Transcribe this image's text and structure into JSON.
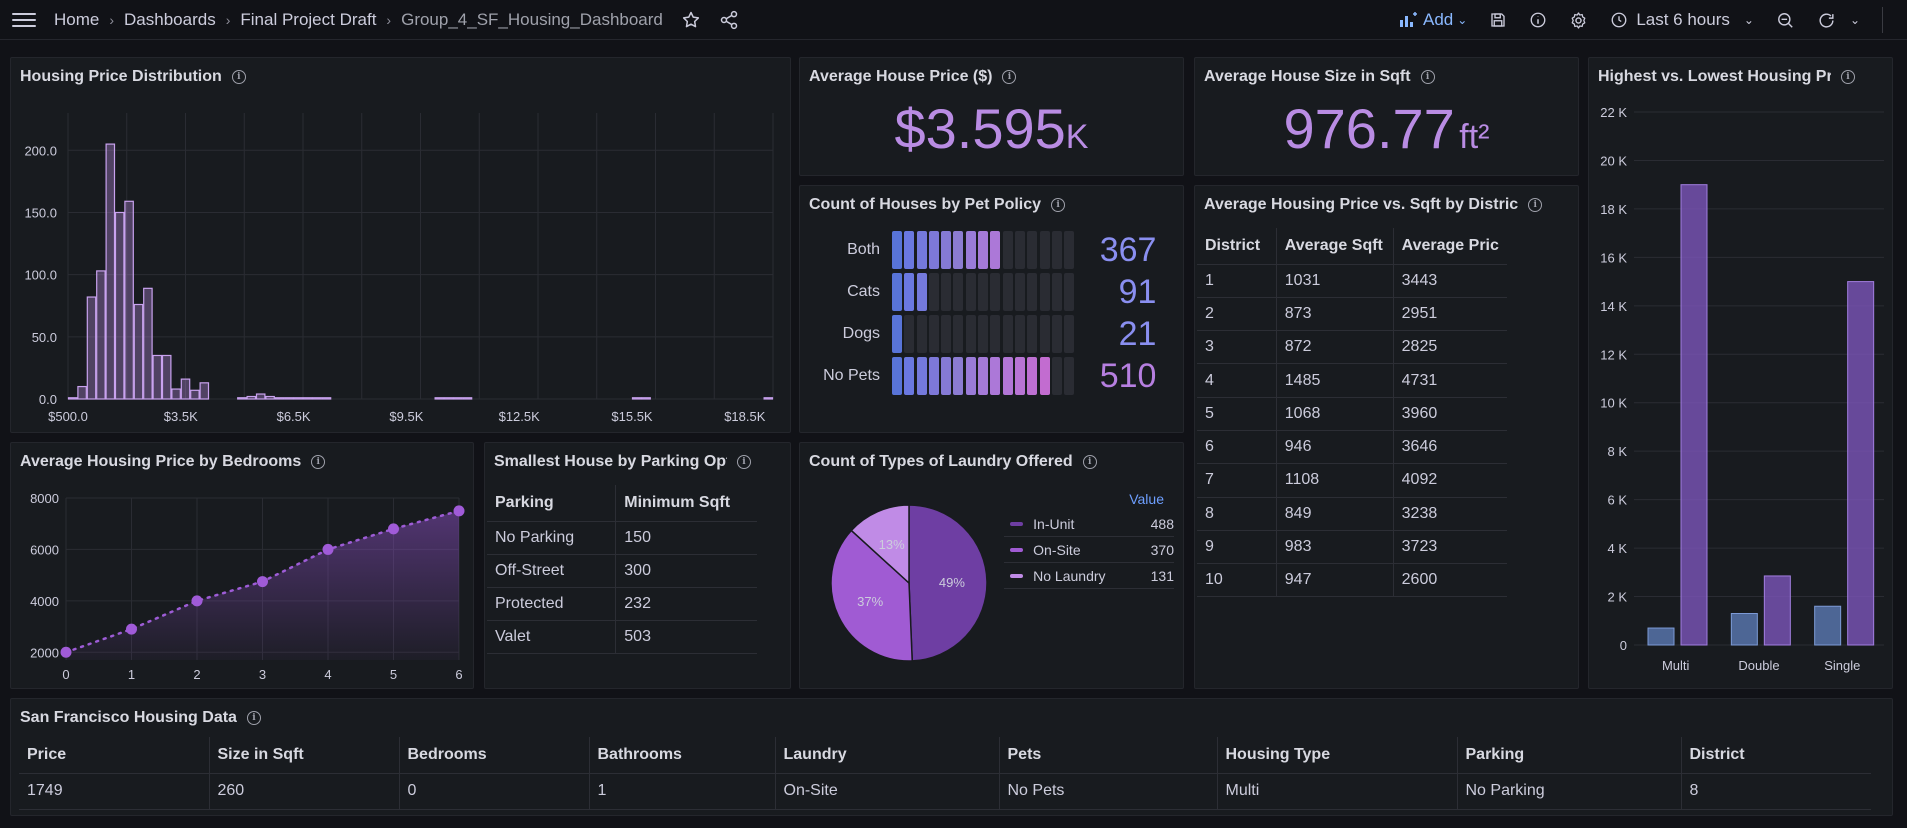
{
  "topbar": {
    "breadcrumbs": [
      "Home",
      "Dashboards",
      "Final Project Draft",
      "Group_4_SF_Housing_Dashboard"
    ],
    "add_label": "Add",
    "time_range": "Last 6 hours"
  },
  "panels": {
    "histogram": {
      "title": "Housing Price Distribution"
    },
    "avg_price": {
      "title": "Average House Price ($)",
      "value": "$3.595",
      "unit": "K"
    },
    "avg_size": {
      "title": "Average House Size in Sqft",
      "value": "976.77",
      "unit": "ft²"
    },
    "high_low": {
      "title": "Highest vs. Lowest Housing Pr"
    },
    "pet_policy": {
      "title": "Count of Houses by Pet Policy",
      "rows": [
        {
          "label": "Both",
          "value": "367",
          "lit": 9
        },
        {
          "label": "Cats",
          "value": "91",
          "lit": 3
        },
        {
          "label": "Dogs",
          "value": "21",
          "lit": 1
        },
        {
          "label": "No Pets",
          "value": "510",
          "lit": 13
        }
      ]
    },
    "district_table": {
      "title": "Average Housing Price vs. Sqft by Distric",
      "headers": [
        "District",
        "Average Sqft",
        "Average Pric"
      ],
      "rows": [
        [
          "1",
          "1031",
          "3443"
        ],
        [
          "2",
          "873",
          "2951"
        ],
        [
          "3",
          "872",
          "2825"
        ],
        [
          "4",
          "1485",
          "4731"
        ],
        [
          "5",
          "1068",
          "3960"
        ],
        [
          "6",
          "946",
          "3646"
        ],
        [
          "7",
          "1108",
          "4092"
        ],
        [
          "8",
          "849",
          "3238"
        ],
        [
          "9",
          "983",
          "3723"
        ],
        [
          "10",
          "947",
          "2600"
        ]
      ]
    },
    "bedrooms": {
      "title": "Average Housing Price by Bedrooms"
    },
    "parking": {
      "title": "Smallest House by Parking Opt",
      "headers": [
        "Parking",
        "Minimum Sqft"
      ],
      "rows": [
        [
          "No Parking",
          "150"
        ],
        [
          "Off-Street",
          "300"
        ],
        [
          "Protected",
          "232"
        ],
        [
          "Valet",
          "503"
        ]
      ]
    },
    "laundry": {
      "title": "Count of Types of Laundry Offered",
      "legend_header": "Value",
      "legend": [
        {
          "name": "In-Unit",
          "value": "488"
        },
        {
          "name": "On-Site",
          "value": "370"
        },
        {
          "name": "No Laundry",
          "value": "131"
        }
      ]
    },
    "sf_data": {
      "title": "San Francisco Housing Data",
      "headers": [
        "Price",
        "Size in Sqft",
        "Bedrooms",
        "Bathrooms",
        "Laundry",
        "Pets",
        "Housing Type",
        "Parking",
        "District"
      ],
      "row": [
        "1749",
        "260",
        "0",
        "1",
        "On-Site",
        "No Pets",
        "Multi",
        "No Parking",
        "8"
      ]
    }
  },
  "chart_data": [
    {
      "type": "bar",
      "title": "Housing Price Distribution",
      "x": [
        500,
        750,
        1000,
        1250,
        1500,
        1750,
        2000,
        2250,
        2500,
        2750,
        3000,
        3250,
        3500,
        3750,
        4000,
        4250,
        4500,
        4750,
        5000,
        5250,
        5500,
        5750,
        6000,
        6250,
        6500,
        6750,
        7000,
        7250,
        7500,
        7750,
        8000,
        8250,
        8500,
        8750,
        9000,
        9250,
        9500,
        9750,
        10000,
        10250,
        10500,
        10750,
        11000,
        11250,
        11500,
        11750,
        12000,
        12250,
        12500,
        12750,
        13000,
        13250,
        13500,
        13750,
        14000,
        14250,
        14500,
        14750,
        15000,
        15250,
        15500,
        15750,
        16000,
        16250,
        16500,
        16750,
        17000,
        17250,
        17500,
        17750,
        18000,
        18250,
        18500,
        18750,
        19000
      ],
      "values": [
        1,
        10,
        82,
        103,
        205,
        150,
        159,
        76,
        89,
        35,
        35,
        8,
        16,
        7,
        13,
        0,
        0,
        0,
        1,
        2,
        4,
        2,
        1,
        1,
        1,
        1,
        1,
        1,
        0,
        0,
        0,
        0,
        0,
        0,
        0,
        0,
        0,
        0,
        0,
        1,
        1,
        1,
        1,
        0,
        0,
        0,
        0,
        0,
        0,
        0,
        0,
        0,
        0,
        0,
        0,
        0,
        0,
        0,
        0,
        0,
        1,
        1,
        0,
        0,
        0,
        0,
        0,
        0,
        0,
        0,
        0,
        0,
        0,
        0,
        1
      ],
      "xticks": [
        "$500.0",
        "$3.5K",
        "$6.5K",
        "$9.5K",
        "$12.5K",
        "$15.5K",
        "$18.5K"
      ],
      "yticks": [
        "0.0",
        "50.0",
        "100.0",
        "150.0",
        "200.0"
      ],
      "ylim": [
        0,
        230
      ]
    },
    {
      "type": "bar",
      "title": "Highest vs. Lowest Housing Pr",
      "categories": [
        "Multi",
        "Double",
        "Single"
      ],
      "series": [
        {
          "values": [
            700,
            1300,
            1600
          ],
          "color": "#5b79b3"
        },
        {
          "values": [
            19000,
            2850,
            15000
          ],
          "color": "#7c55b9"
        }
      ],
      "yticks": [
        "0",
        "2 K",
        "4 K",
        "6 K",
        "8 K",
        "10 K",
        "12 K",
        "14 K",
        "16 K",
        "18 K",
        "20 K",
        "22 K"
      ],
      "ylim": [
        0,
        22000
      ]
    },
    {
      "type": "line",
      "title": "Average Housing Price by Bedrooms",
      "x": [
        0,
        1,
        2,
        3,
        4,
        5,
        6
      ],
      "values": [
        2000,
        2900,
        4000,
        4750,
        6000,
        6800,
        7500
      ],
      "xticks": [
        "0",
        "1",
        "2",
        "3",
        "4",
        "5",
        "6"
      ],
      "yticks": [
        "2000",
        "4000",
        "6000",
        "8000"
      ],
      "ylim": [
        1700,
        8000
      ]
    },
    {
      "type": "pie",
      "title": "Count of Types of Laundry Offered",
      "categories": [
        "In-Unit",
        "On-Site",
        "No Laundry"
      ],
      "values": [
        488,
        370,
        131
      ],
      "labels": [
        "49%",
        "37%",
        "13%"
      ],
      "colors": [
        "#6e3ea3",
        "#a05bd3",
        "#c08be6"
      ]
    }
  ],
  "colors": {
    "accent_purple": "#b98ce3",
    "stat_blue": "#8ab8ff",
    "panel_bg": "#181b1f"
  }
}
